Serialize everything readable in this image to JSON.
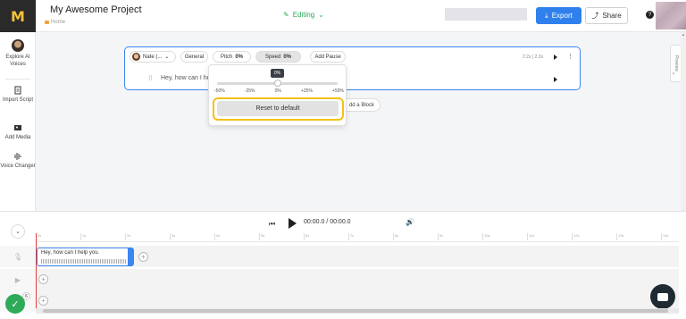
{
  "header": {
    "project_title": "My Awesome Project",
    "breadcrumb": "Home",
    "status": "Editing",
    "export_label": "Export",
    "share_label": "Share",
    "help_label": "?"
  },
  "sidebar": {
    "items": [
      {
        "label": "Explore AI Voices",
        "icon": "voice-avatar"
      },
      {
        "label": "Import Script",
        "icon": "import-icon"
      },
      {
        "label": "Add Media",
        "icon": "media-icon"
      },
      {
        "label": "Voice Changer",
        "icon": "voice-changer-icon"
      }
    ]
  },
  "preview_tab": "Preview",
  "block": {
    "voice_name": "Nate (...",
    "style": "General",
    "pitch_label": "Pitch",
    "pitch_value": "0%",
    "speed_label": "Speed",
    "speed_value": "0%",
    "add_pause": "Add Pause",
    "duration": "2.2s | 2.2s",
    "text": "Hey, how can I help you."
  },
  "block_text_visible": "Hey, how can I he",
  "add_block_label": "dd a Block",
  "speed_popover": {
    "current": "0%",
    "ticks": [
      "-50%",
      "-25%",
      "0%",
      "+25%",
      "+50%"
    ],
    "reset_label": "Reset to default"
  },
  "timeline": {
    "time": "00:00.0 / 00:00.0",
    "ruler": [
      "0s",
      "1s",
      "2s",
      "3s",
      "4s",
      "5s",
      "6s",
      "7s",
      "8s",
      "9s",
      "10s",
      "11s",
      "12s",
      "13s",
      "14s"
    ],
    "clip_text": "Hey, how can I help you.",
    "badge_count": "6"
  },
  "colors": {
    "accent": "#2f80ed",
    "highlight": "#f5c019",
    "editing_green": "#2eaa5a",
    "playhead": "#e03b3b"
  }
}
